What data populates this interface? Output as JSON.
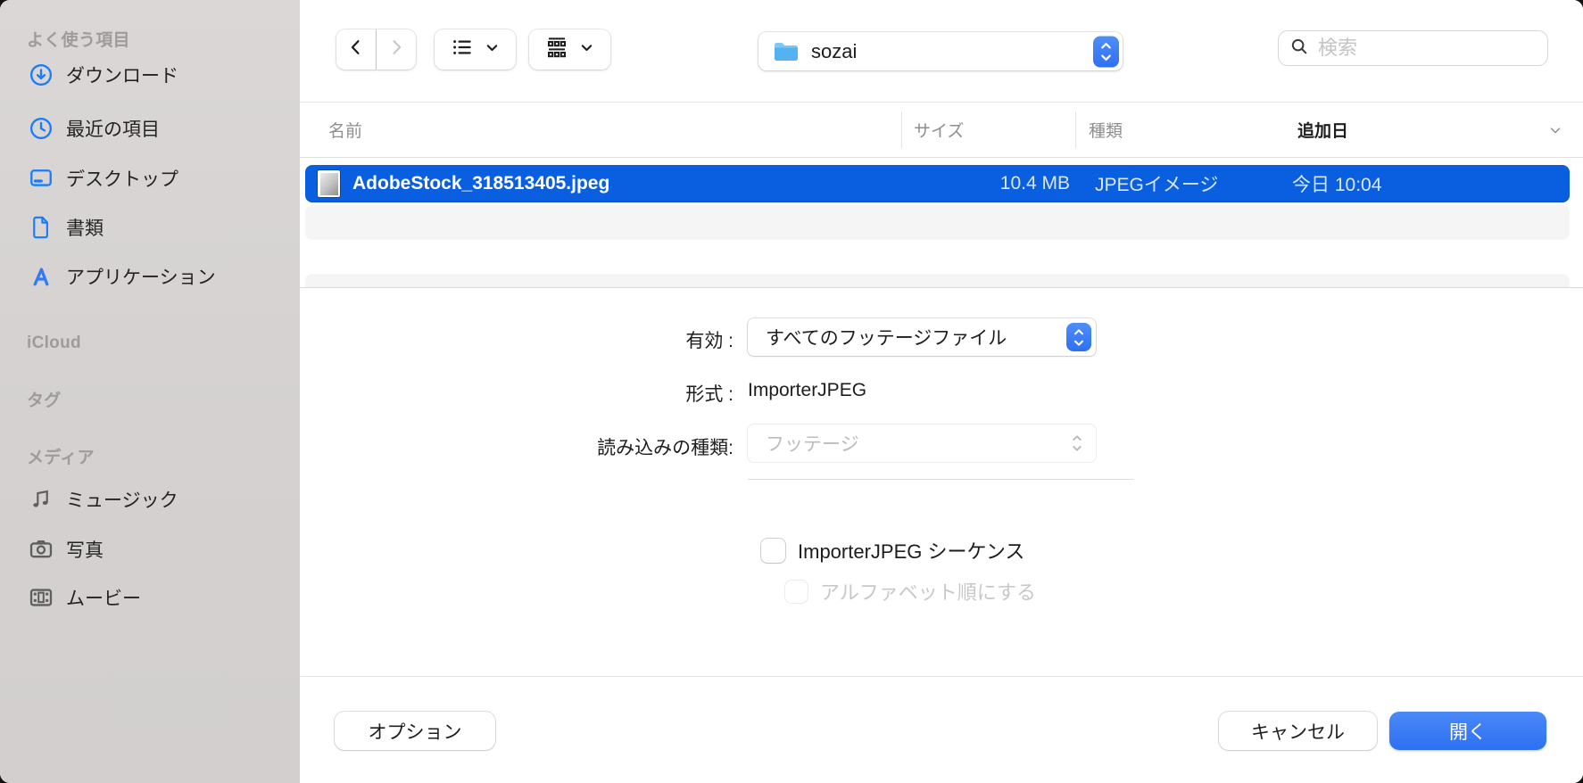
{
  "colors": {
    "selection_blue": "#0a5fe0",
    "accent_blue": "#3478f6",
    "sidebar_icon_blue": "#1a7cfc",
    "media_icon_gray": "#5f5f5f",
    "sidebar_bg": "#d6d3d2",
    "stripe_gray": "#f5f5f5",
    "disabled_text": "#c8c8c8"
  },
  "sidebar": {
    "sections": [
      {
        "title": "よく使う項目",
        "items": [
          {
            "label": "ダウンロード",
            "icon": "download-circle-icon"
          },
          {
            "label": "最近の項目",
            "icon": "clock-icon"
          },
          {
            "label": "デスクトップ",
            "icon": "desktop-icon"
          },
          {
            "label": "書類",
            "icon": "document-icon"
          },
          {
            "label": "アプリケーション",
            "icon": "appstore-icon"
          }
        ]
      },
      {
        "title": "iCloud",
        "items": []
      },
      {
        "title": "タグ",
        "items": []
      },
      {
        "title": "メディア",
        "items": [
          {
            "label": "ミュージック",
            "icon": "music-note-icon"
          },
          {
            "label": "写真",
            "icon": "camera-icon"
          },
          {
            "label": "ムービー",
            "icon": "film-icon"
          }
        ]
      }
    ]
  },
  "toolbar": {
    "back_icon": "chevron-left-icon",
    "forward_icon": "chevron-right-icon",
    "list_view_icon": "list-view-icon",
    "group_view_icon": "group-view-icon",
    "folder_select": {
      "value": "sozai",
      "icon": "folder-icon"
    },
    "search": {
      "placeholder": "検索",
      "icon": "search-icon"
    }
  },
  "list": {
    "columns": {
      "name": "名前",
      "size": "サイズ",
      "kind": "種類",
      "date_added": "追加日"
    },
    "sort_column": "追加日",
    "row": {
      "name": "AdobeStock_318513405.jpeg",
      "size": "10.4 MB",
      "kind": "JPEGイメージ",
      "date_added": "今日 10:04",
      "selected": true
    }
  },
  "form": {
    "enable_label": "有効 :",
    "enable_value": "すべてのフッテージファイル",
    "format_label": "形式 :",
    "format_value": "ImporterJPEG",
    "import_kind_label": "読み込みの種類:",
    "import_kind_value": "フッテージ",
    "import_kind_disabled": true,
    "sequence_checkbox": {
      "label": "ImporterJPEG シーケンス",
      "checked": false,
      "disabled": false
    },
    "alphabetical_checkbox": {
      "label": "アルファベット順にする",
      "checked": false,
      "disabled": true
    }
  },
  "footer": {
    "options": "オプション",
    "cancel": "キャンセル",
    "open": "開く"
  }
}
